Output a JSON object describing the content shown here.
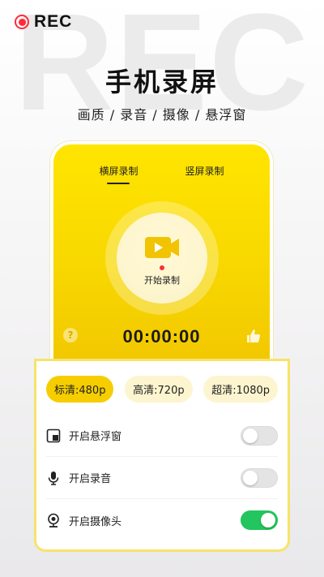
{
  "header": {
    "watermark": "REC",
    "rec_label": "REC",
    "title": "手机录屏",
    "subtitle": "画质 / 录音 / 摄像 / 悬浮窗"
  },
  "recorder": {
    "tabs": [
      {
        "label": "横屏录制",
        "active": true
      },
      {
        "label": "竖屏录制",
        "active": false
      }
    ],
    "start_label": "开始录制",
    "timer": "00:00:00",
    "help_symbol": "?"
  },
  "quality": {
    "options": [
      {
        "label": "标清:480p",
        "active": true
      },
      {
        "label": "高清:720p",
        "active": false
      },
      {
        "label": "超清:1080p",
        "active": false
      }
    ]
  },
  "settings": [
    {
      "label": "开启悬浮窗",
      "icon": "floating-window-icon",
      "on": false
    },
    {
      "label": "开启录音",
      "icon": "microphone-icon",
      "on": false
    },
    {
      "label": "开启摄像头",
      "icon": "camera-icon",
      "on": true
    }
  ],
  "colors": {
    "accent_yellow": "#f6ce00",
    "rec_red": "#ff2b3a",
    "toggle_on": "#22c55e"
  }
}
